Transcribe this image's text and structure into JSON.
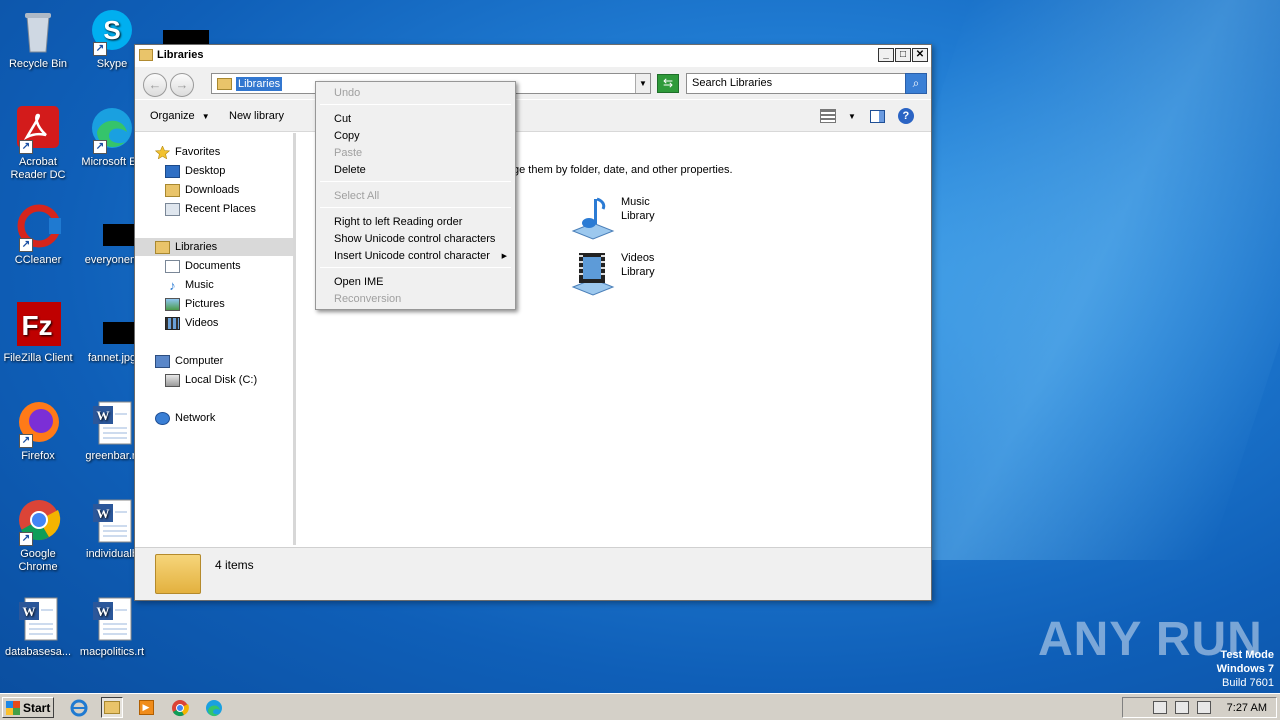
{
  "desktop": {
    "icons": [
      {
        "label": "Recycle Bin"
      },
      {
        "label": "Skype"
      },
      {
        "label": "Acrobat Reader DC"
      },
      {
        "label": "Microsoft Ed"
      },
      {
        "label": "CCleaner"
      },
      {
        "label": "everyonem"
      },
      {
        "label": "FileZilla Client"
      },
      {
        "label": "fannet.jpg"
      },
      {
        "label": "Firefox"
      },
      {
        "label": "greenbar.rt"
      },
      {
        "label": "Google Chrome"
      },
      {
        "label": "individualb"
      },
      {
        "label": "databasesa..."
      },
      {
        "label": "macpolitics.rt"
      }
    ]
  },
  "window": {
    "title": "Libraries",
    "address": "Libraries",
    "search_placeholder": "Search Libraries",
    "toolbar": {
      "organize": "Organize",
      "new_library": "New library"
    },
    "nav": {
      "favorites": "Favorites",
      "desktop": "Desktop",
      "downloads": "Downloads",
      "recent": "Recent Places",
      "libraries": "Libraries",
      "documents": "Documents",
      "music": "Music",
      "pictures": "Pictures",
      "videos": "Videos",
      "computer": "Computer",
      "localdisk": "Local Disk (C:)",
      "network": "Network"
    },
    "content": {
      "intro": "ge them by folder, date, and other properties.",
      "libraries": [
        {
          "name": "Music",
          "type": "Library"
        },
        {
          "name": "Videos",
          "type": "Library"
        }
      ]
    },
    "status": "4 items"
  },
  "context_menu": {
    "undo": "Undo",
    "cut": "Cut",
    "copy": "Copy",
    "paste": "Paste",
    "delete": "Delete",
    "select_all": "Select All",
    "rtl": "Right to left Reading order",
    "show_unicode": "Show Unicode control characters",
    "insert_unicode": "Insert Unicode control character",
    "open_ime": "Open IME",
    "reconversion": "Reconversion"
  },
  "taskbar": {
    "start": "Start",
    "clock": "7:27 AM"
  },
  "watermark": "ANY RUN",
  "test_mode": {
    "line1": "Test Mode",
    "line2": "Windows 7",
    "line3": "Build 7601"
  }
}
